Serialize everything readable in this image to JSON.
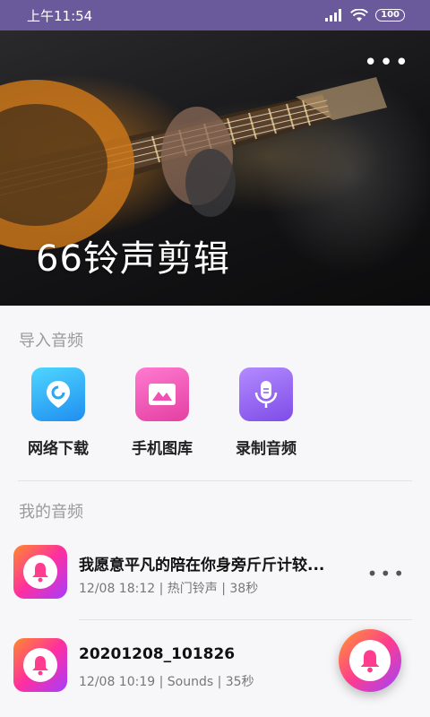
{
  "status_bar": {
    "time": "上午11:54",
    "battery": "100",
    "icons": [
      "signal-icon",
      "wifi-icon",
      "battery-icon"
    ]
  },
  "hero": {
    "title": "66铃声剪辑",
    "more_icon": "more-horizontal-icon"
  },
  "import_section": {
    "title": "导入音频",
    "items": [
      {
        "label": "网络下载",
        "icon": "network-download-icon",
        "color": "#2fa8f5"
      },
      {
        "label": "手机图库",
        "icon": "phone-gallery-icon",
        "color": "#f056b0"
      },
      {
        "label": "录制音频",
        "icon": "microphone-icon",
        "color": "#8a5cf0"
      }
    ]
  },
  "my_audio": {
    "title": "我的音频",
    "items": [
      {
        "name": "我愿意平凡的陪在你身旁斤斤计较...",
        "meta": "12/08 18:12 | 热门铃声 | 38秒"
      },
      {
        "name": "20201208_101826",
        "meta": "12/08 10:19 | Sounds | 35秒"
      }
    ]
  },
  "colors": {
    "status_bar": "#6a5a9b",
    "accent_gradient_start": "#ff8a2c",
    "accent_gradient_end": "#a53cff"
  }
}
